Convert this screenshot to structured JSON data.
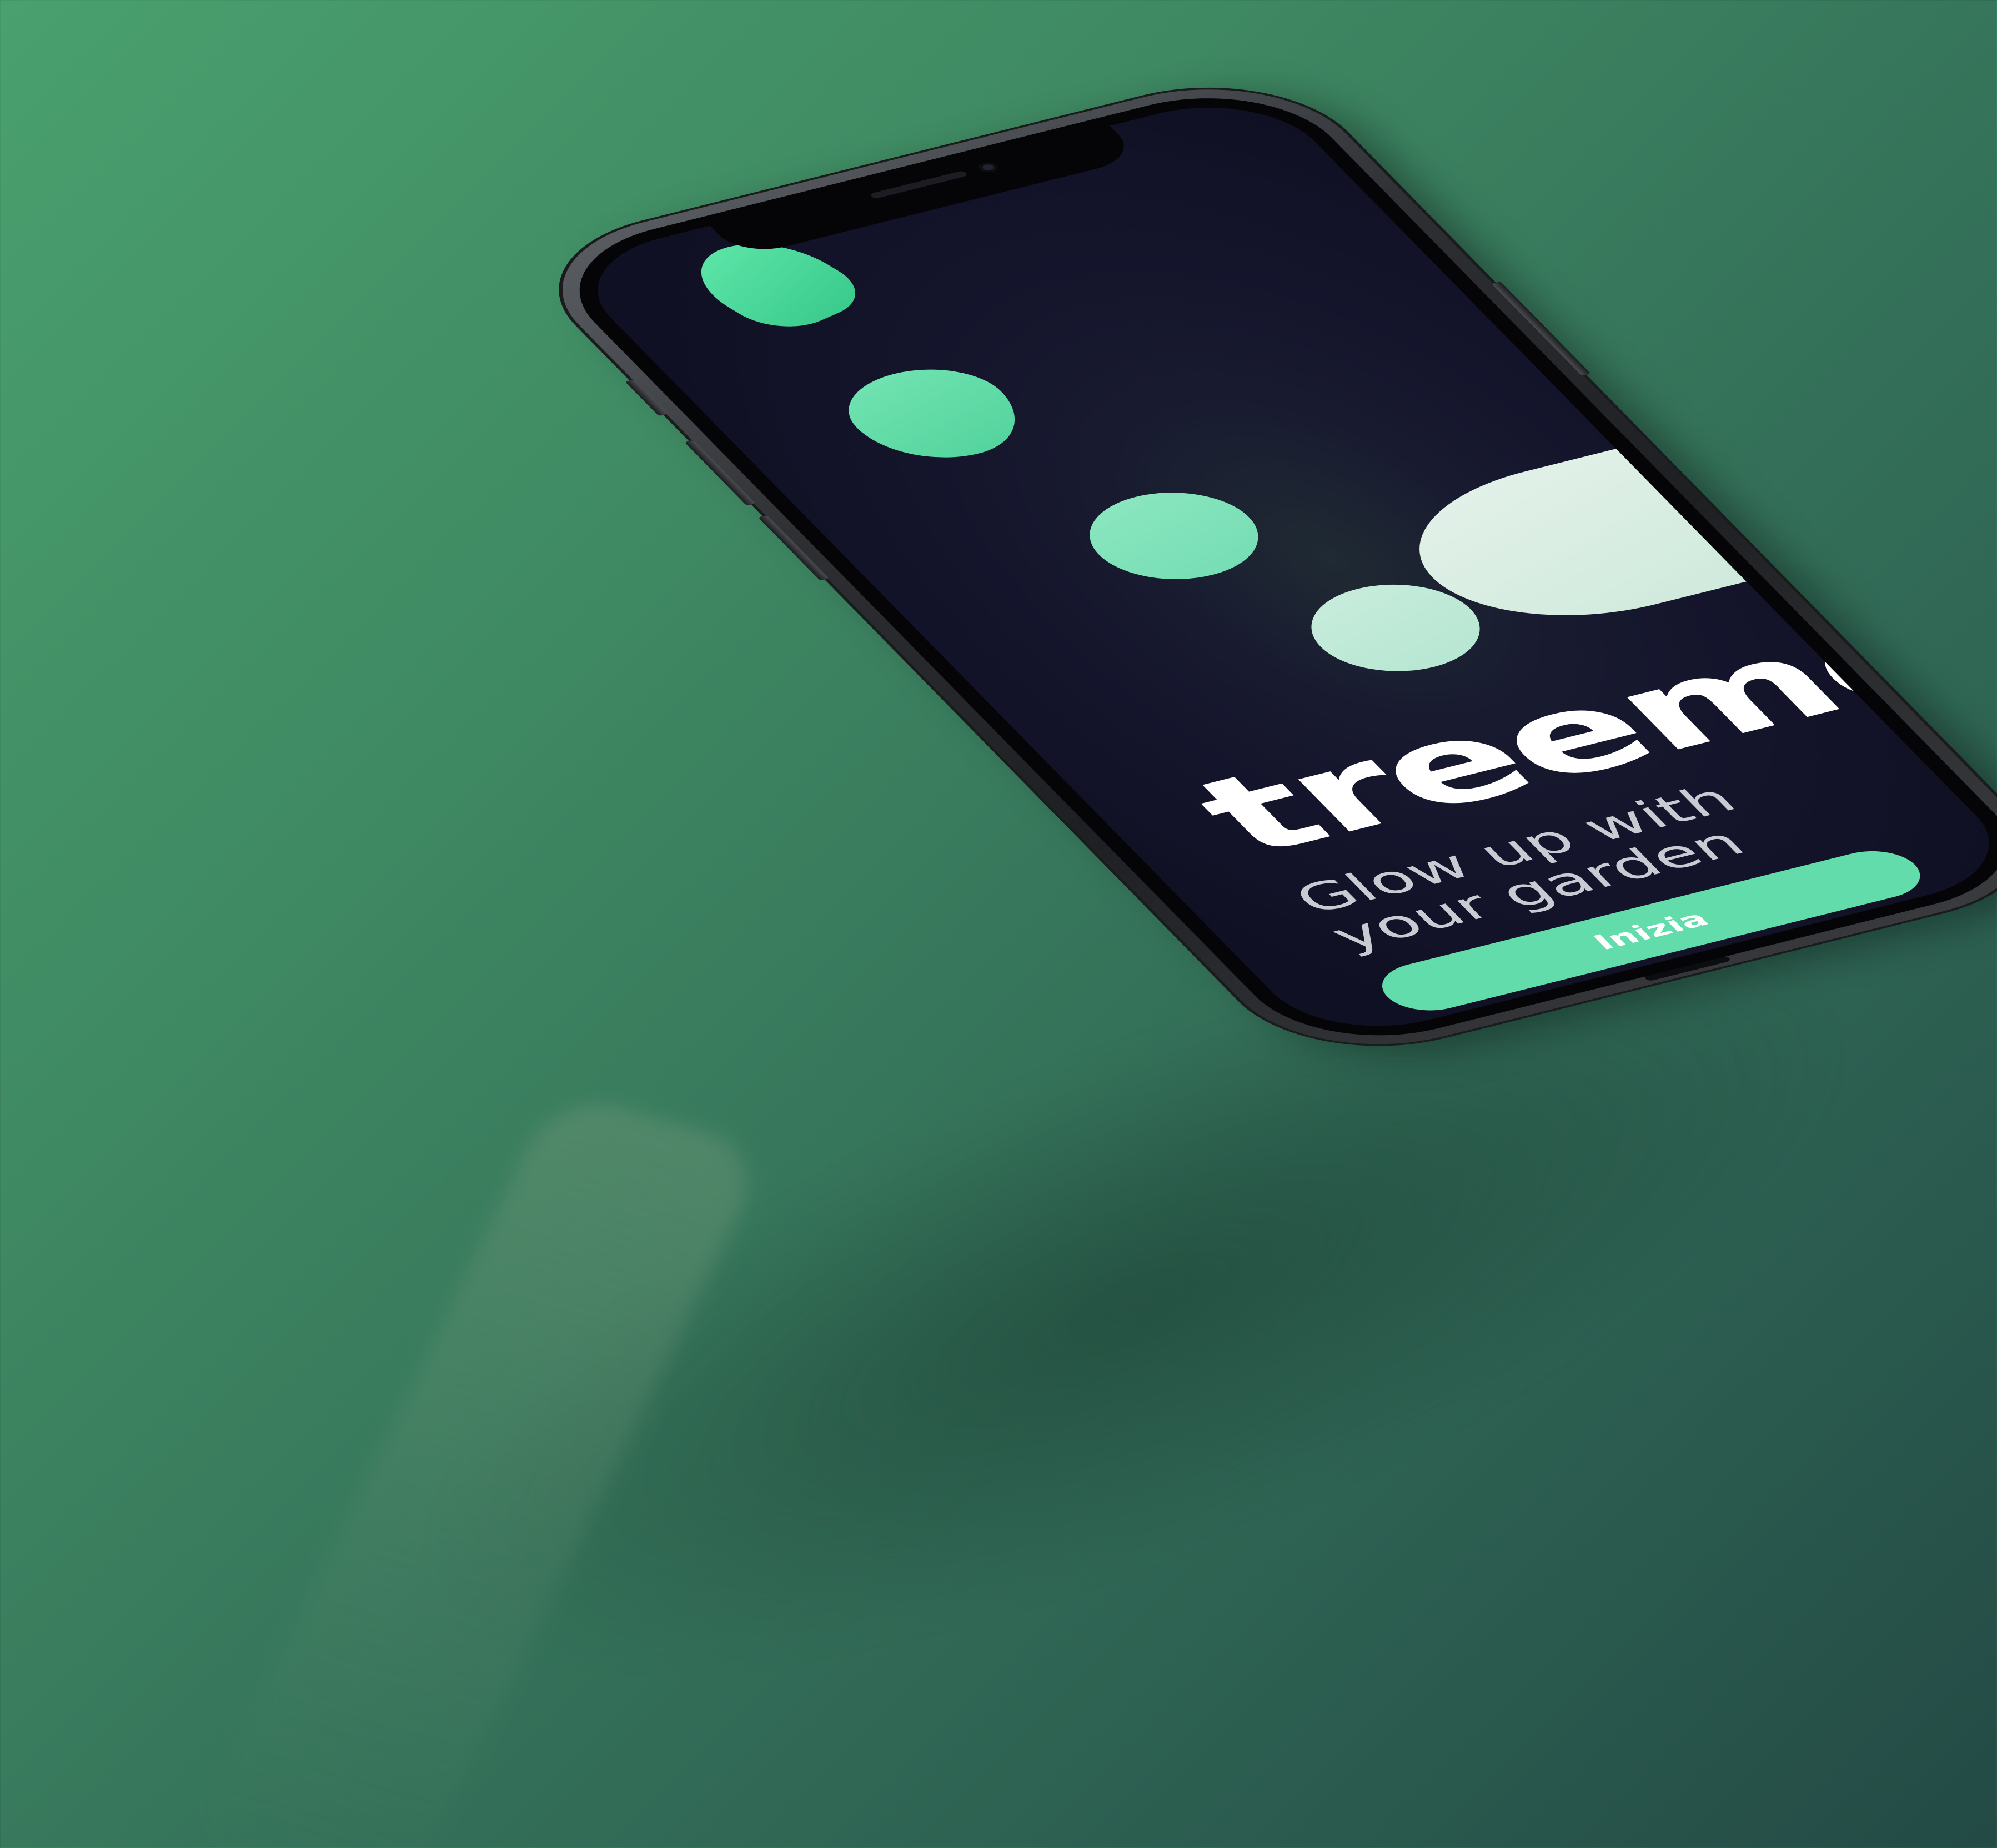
{
  "app": {
    "brand": "treeme",
    "tagline_line1": "Glow up with",
    "tagline_line2": "your garden",
    "cta_label": "Inizia"
  },
  "colors": {
    "accent": "#62dcab",
    "screen_background": "#15152c",
    "leaf_dark": "#38c98a",
    "leaf_light": "#cfe9dc"
  },
  "icons": {
    "decor": [
      "leaf-blob",
      "leaf-blob",
      "circle-blob",
      "circle-blob",
      "wave-blob"
    ]
  }
}
